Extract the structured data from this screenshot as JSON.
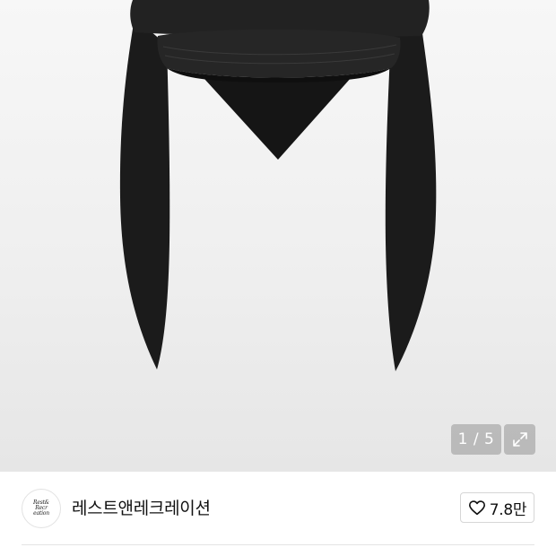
{
  "gallery": {
    "current_page": "1",
    "separator": "/",
    "total_pages": "5",
    "expand_icon": "expand-arrows-icon"
  },
  "brand": {
    "logo_lines": [
      "Rest&",
      "Recr",
      "eation"
    ],
    "name": "레스트앤레크레이션"
  },
  "like": {
    "icon": "heart-outline-icon",
    "count": "7.8만"
  }
}
